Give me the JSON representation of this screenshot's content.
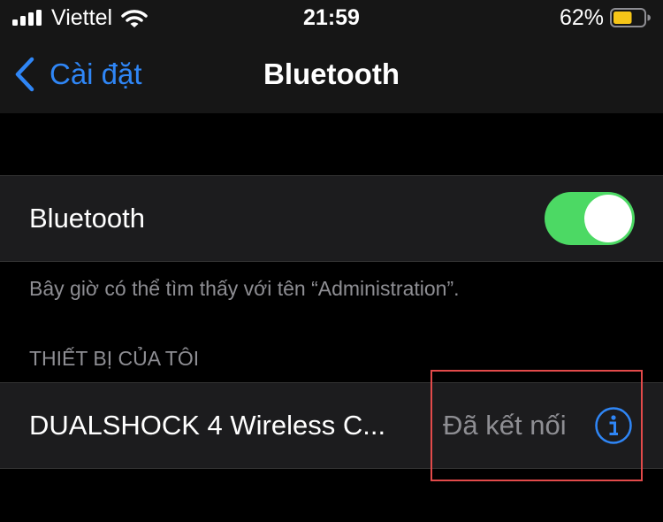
{
  "status_bar": {
    "carrier": "Viettel",
    "time": "21:59",
    "battery_percent": "62%",
    "battery_level": 0.62,
    "battery_color": "#f5c518",
    "signal_icon": "cellular-signal-icon",
    "wifi_icon": "wifi-icon"
  },
  "nav": {
    "back_label": "Cài đặt",
    "title": "Bluetooth"
  },
  "bluetooth": {
    "label": "Bluetooth",
    "enabled": true,
    "footnote": "Bây giờ có thể tìm thấy với tên “Administration”."
  },
  "my_devices": {
    "header": "THIẾT BỊ CỦA TÔI",
    "devices": [
      {
        "name": "DUALSHOCK 4 Wireless C...",
        "status": "Đã kết nối",
        "info_icon": "info-icon"
      }
    ]
  },
  "colors": {
    "accent": "#2f86f6",
    "toggle_on": "#4cd964",
    "highlight": "#e24a4a",
    "secondary_text": "#8e8e93"
  }
}
